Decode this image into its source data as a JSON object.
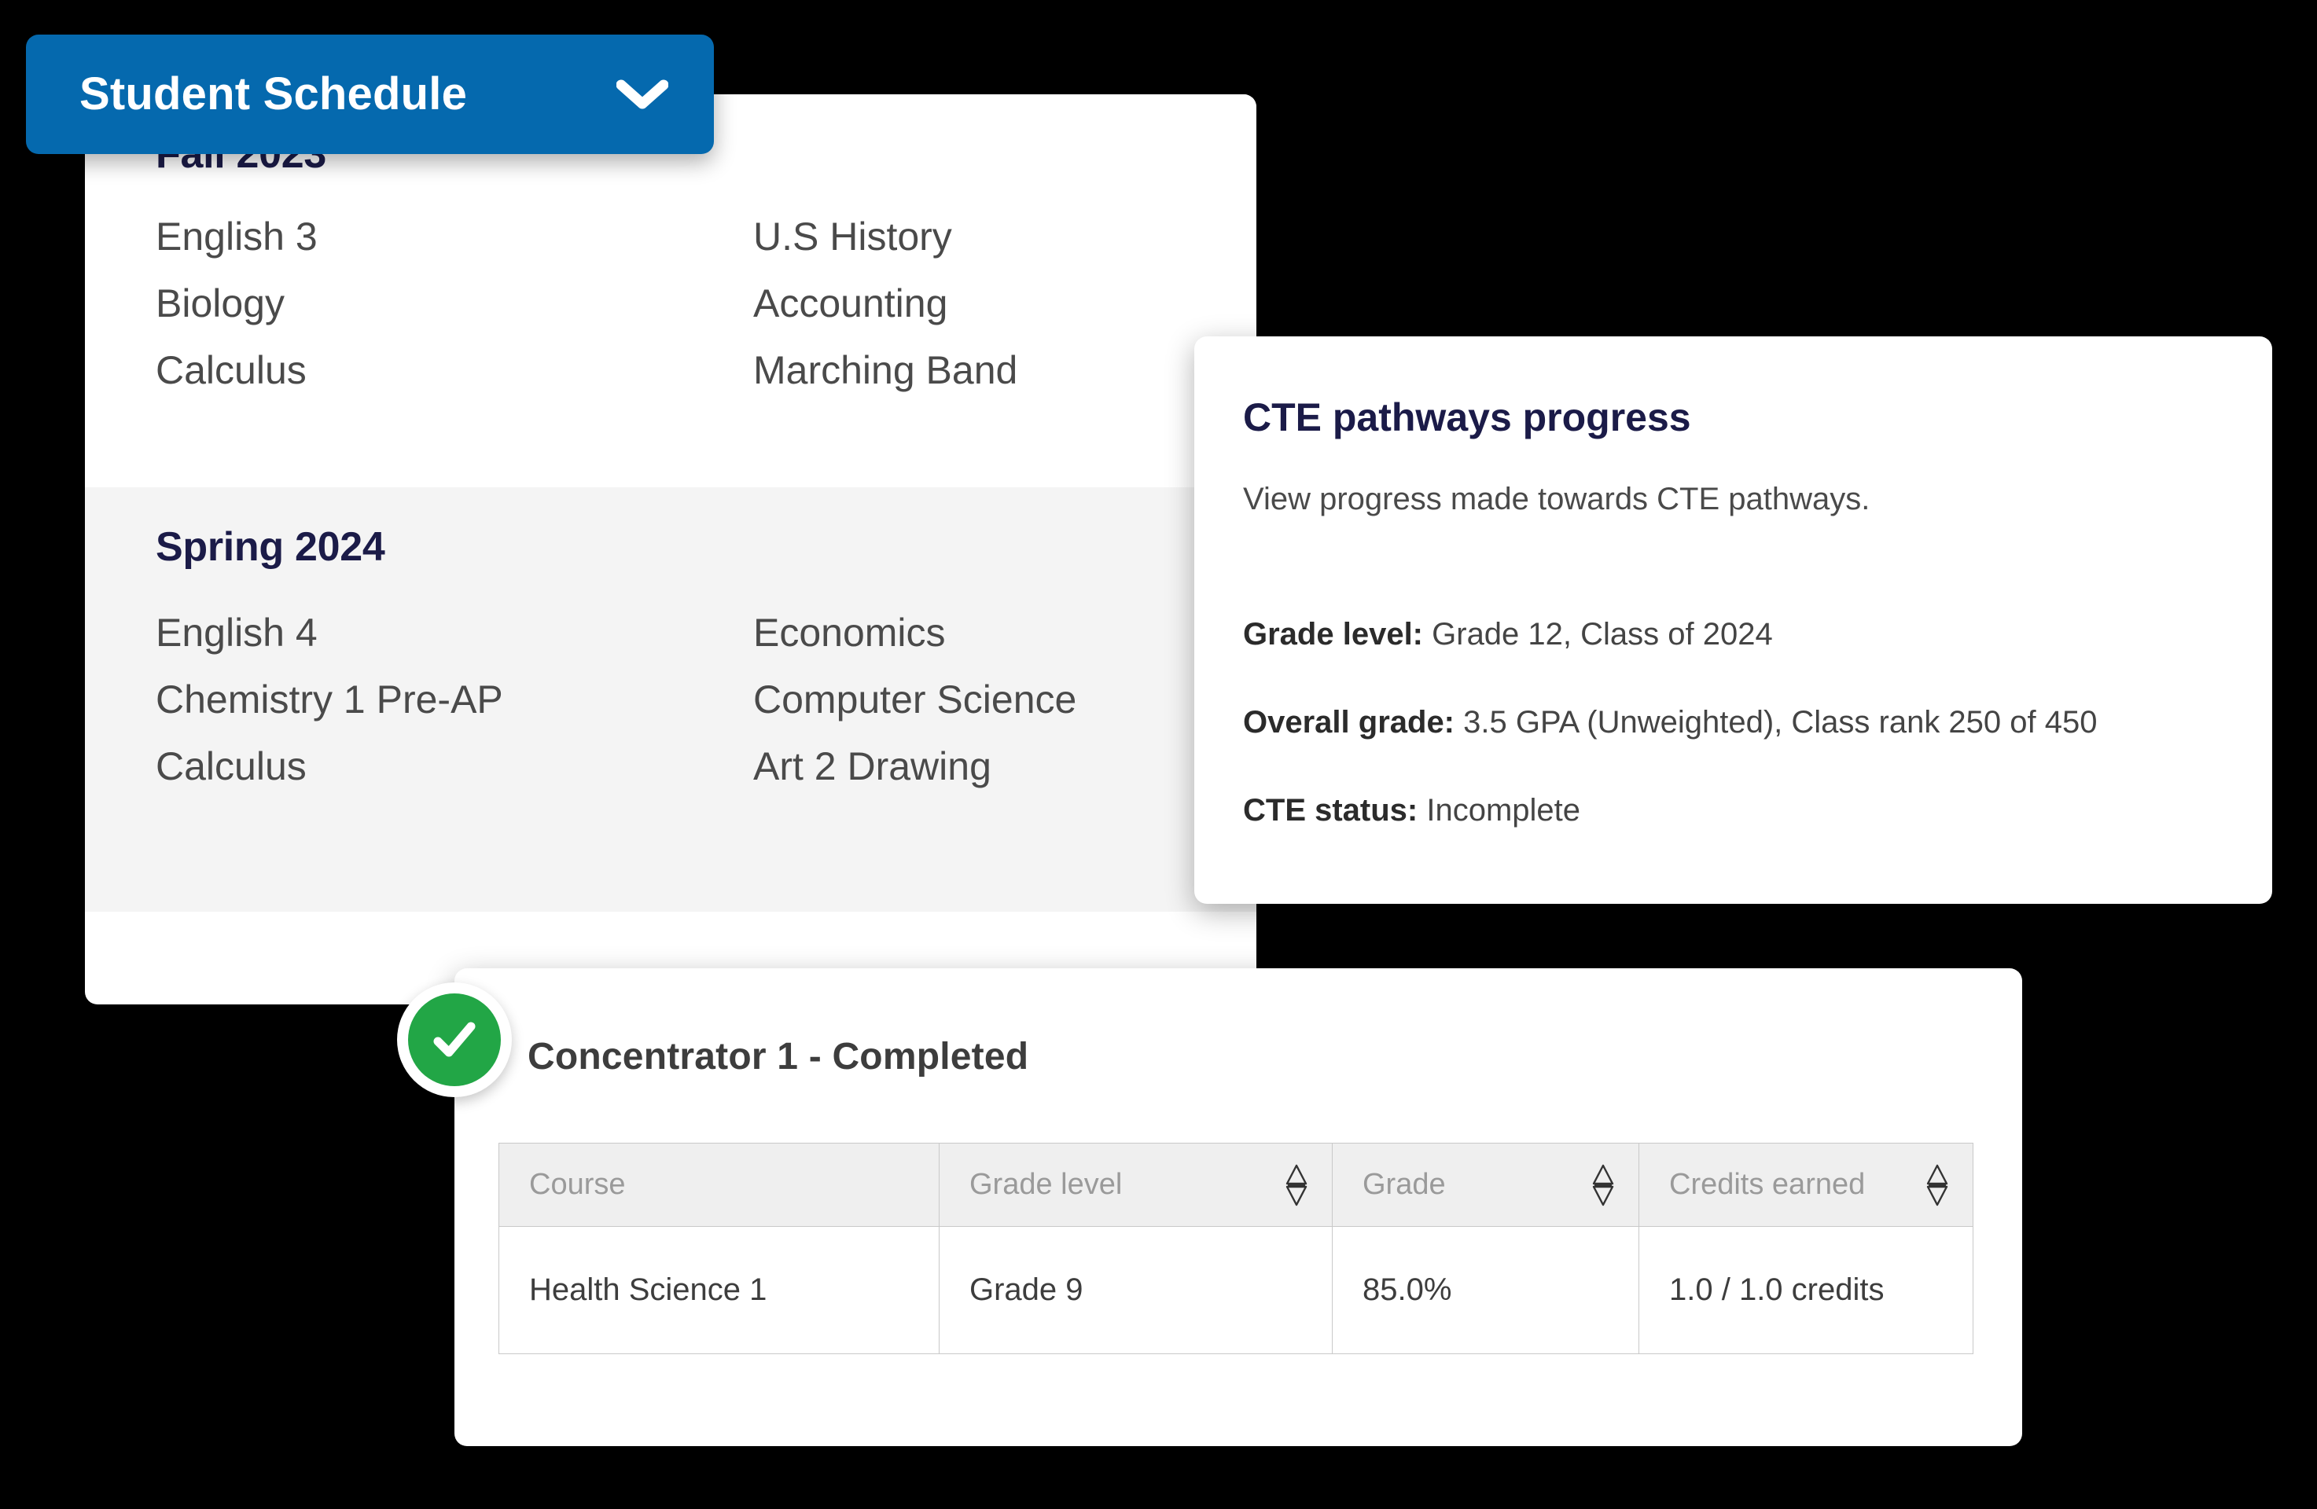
{
  "schedule": {
    "toggle_label": "Student Schedule",
    "toggle_icon": "chevron-down-icon",
    "terms": [
      {
        "title": "Fall 2023",
        "courses_left": [
          "English 3",
          "Biology",
          "Calculus"
        ],
        "courses_right": [
          "U.S History",
          "Accounting",
          "Marching Band"
        ]
      },
      {
        "title": "Spring 2024",
        "courses_left": [
          "English 4",
          "Chemistry 1 Pre-AP",
          "Calculus"
        ],
        "courses_right": [
          "Economics",
          "Computer Science",
          "Art 2 Drawing"
        ]
      }
    ]
  },
  "cte": {
    "title": "CTE pathways progress",
    "subtitle": "View progress made towards CTE pathways.",
    "details": [
      {
        "label": "Grade level:",
        "value": " Grade 12, Class of 2024"
      },
      {
        "label": "Overall grade:",
        "value": " 3.5 GPA (Unweighted), Class rank 250 of 450"
      },
      {
        "label": "CTE status:",
        "value": "  Incomplete"
      }
    ]
  },
  "concentrator": {
    "heading": "Concentrator 1 -  Completed",
    "status_icon": "check-circle-icon",
    "table": {
      "columns": [
        {
          "label": "Course",
          "sortable": false
        },
        {
          "label": "Grade level",
          "sortable": true,
          "sort_icon": "sort-updown-icon"
        },
        {
          "label": "Grade",
          "sortable": true,
          "sort_icon": "sort-updown-icon"
        },
        {
          "label": "Credits earned",
          "sortable": true,
          "sort_icon": "sort-updown-icon"
        }
      ],
      "rows": [
        {
          "course": "Health Science 1",
          "grade_level": "Grade 9",
          "grade": "85.0%",
          "credits_earned": "1.0 / 1.0 credits"
        }
      ]
    }
  },
  "colors": {
    "brand_blue": "#0569ae",
    "heading_navy": "#1b1b48",
    "success_green": "#22a646",
    "body_gray": "#4a4a4a",
    "table_header_bg": "#efefef",
    "spring_band_bg": "#f4f4f4",
    "page_background": "#000000"
  }
}
